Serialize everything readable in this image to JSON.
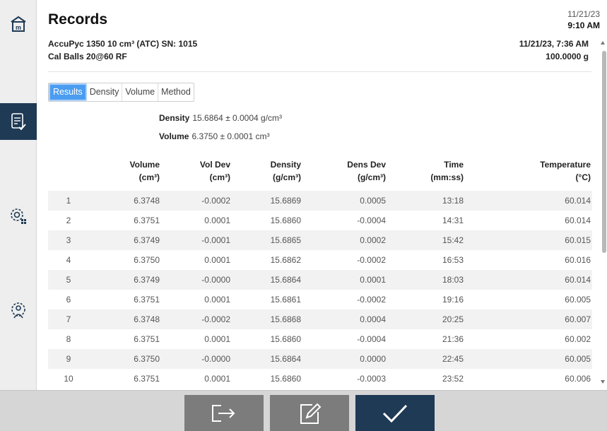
{
  "header": {
    "title": "Records",
    "date": "11/21/23",
    "time": "9:10 AM",
    "instrument": "AccuPyc 1350 10 cm³ (ATC) SN: 1015",
    "sample": "Cal Balls 20@60 RF",
    "record_datetime": "11/21/23, 7:36 AM",
    "mass": "100.0000 g"
  },
  "nav": {
    "items": [
      {
        "icon": "home-icon"
      },
      {
        "icon": "records-icon",
        "active": true
      },
      {
        "icon": "settings-grid-icon"
      },
      {
        "icon": "user-settings-icon"
      }
    ]
  },
  "tabs": [
    {
      "label": "Results",
      "active": true
    },
    {
      "label": "Density"
    },
    {
      "label": "Volume"
    },
    {
      "label": "Method"
    }
  ],
  "summary": {
    "density_label": "Density",
    "density_value": "15.6864 ± 0.0004 g/cm³",
    "volume_label": "Volume",
    "volume_value": "6.3750 ± 0.0001 cm³"
  },
  "table": {
    "columns": [
      {
        "name": "",
        "unit": ""
      },
      {
        "name": "Volume",
        "unit": "(cm³)"
      },
      {
        "name": "Vol Dev",
        "unit": "(cm³)"
      },
      {
        "name": "Density",
        "unit": "(g/cm³)"
      },
      {
        "name": "Dens Dev",
        "unit": "(g/cm³)"
      },
      {
        "name": "Time",
        "unit": "(mm:ss)"
      },
      {
        "name": "Temperature",
        "unit": "(°C)"
      }
    ],
    "rows": [
      [
        "1",
        "6.3748",
        "-0.0002",
        "15.6869",
        "0.0005",
        "13:18",
        "60.014"
      ],
      [
        "2",
        "6.3751",
        "0.0001",
        "15.6860",
        "-0.0004",
        "14:31",
        "60.014"
      ],
      [
        "3",
        "6.3749",
        "-0.0001",
        "15.6865",
        "0.0002",
        "15:42",
        "60.015"
      ],
      [
        "4",
        "6.3750",
        "0.0001",
        "15.6862",
        "-0.0002",
        "16:53",
        "60.016"
      ],
      [
        "5",
        "6.3749",
        "-0.0000",
        "15.6864",
        "0.0001",
        "18:03",
        "60.014"
      ],
      [
        "6",
        "6.3751",
        "0.0001",
        "15.6861",
        "-0.0002",
        "19:16",
        "60.005"
      ],
      [
        "7",
        "6.3748",
        "-0.0002",
        "15.6868",
        "0.0004",
        "20:25",
        "60.007"
      ],
      [
        "8",
        "6.3751",
        "0.0001",
        "15.6860",
        "-0.0004",
        "21:36",
        "60.002"
      ],
      [
        "9",
        "6.3750",
        "-0.0000",
        "15.6864",
        "0.0000",
        "22:45",
        "60.005"
      ],
      [
        "10",
        "6.3751",
        "0.0001",
        "15.6860",
        "-0.0003",
        "23:52",
        "60.006"
      ]
    ]
  },
  "footer": {
    "buttons": [
      {
        "icon": "exit-icon"
      },
      {
        "icon": "edit-icon"
      },
      {
        "icon": "checkmark-icon"
      }
    ]
  },
  "colors": {
    "accent": "#4a9df0",
    "navy": "#1f3a55",
    "button_gray": "#7c7c7c"
  }
}
